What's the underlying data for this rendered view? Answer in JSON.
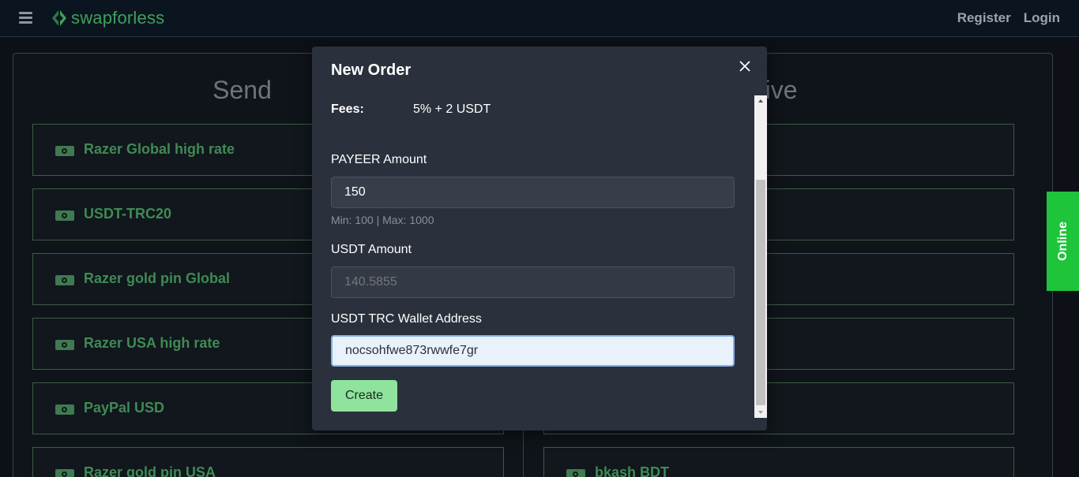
{
  "brand": {
    "name": "swapforless",
    "color": "#3fa05a"
  },
  "nav": {
    "register_label": "Register",
    "login_label": "Login"
  },
  "send": {
    "title": "Send",
    "methods": [
      {
        "label": "Razer Global high rate",
        "icon": "money-icon"
      },
      {
        "label": "USDT-TRC20",
        "icon": "money-icon"
      },
      {
        "label": "Razer gold pin Global",
        "icon": "money-icon"
      },
      {
        "label": "Razer USA high rate",
        "icon": "money-icon"
      },
      {
        "label": "PayPal USD",
        "icon": "money-icon"
      },
      {
        "label": "Razer gold pin USA",
        "icon": "money-icon"
      }
    ]
  },
  "receive": {
    "title": "Receive",
    "visible_title_fragment": "eceive",
    "methods": [
      {
        "label": "",
        "icon": "money-icon"
      },
      {
        "label": "",
        "icon": "money-icon"
      },
      {
        "label": "",
        "icon": "money-icon"
      },
      {
        "label": "",
        "icon": "money-icon"
      },
      {
        "label": "",
        "icon": "money-icon"
      },
      {
        "label": "bkash BDT",
        "icon": "money-icon"
      }
    ]
  },
  "online_tab": {
    "label": "Online",
    "color": "#1ec43a"
  },
  "modal": {
    "title": "New Order",
    "fees_label": "Fees:",
    "fees_value": "5% + 2 USDT",
    "payeer_amount_label": "PAYEER Amount",
    "payeer_amount_value": "150",
    "payeer_amount_hint": "Min: 100 | Max: 1000",
    "usdt_amount_label": "USDT Amount",
    "usdt_amount_placeholder": "140.5855",
    "wallet_label": "USDT TRC Wallet Address",
    "wallet_value": "nocsohfwe873rwwfe7gr",
    "create_label": "Create",
    "create_color": "#8fe39c"
  }
}
